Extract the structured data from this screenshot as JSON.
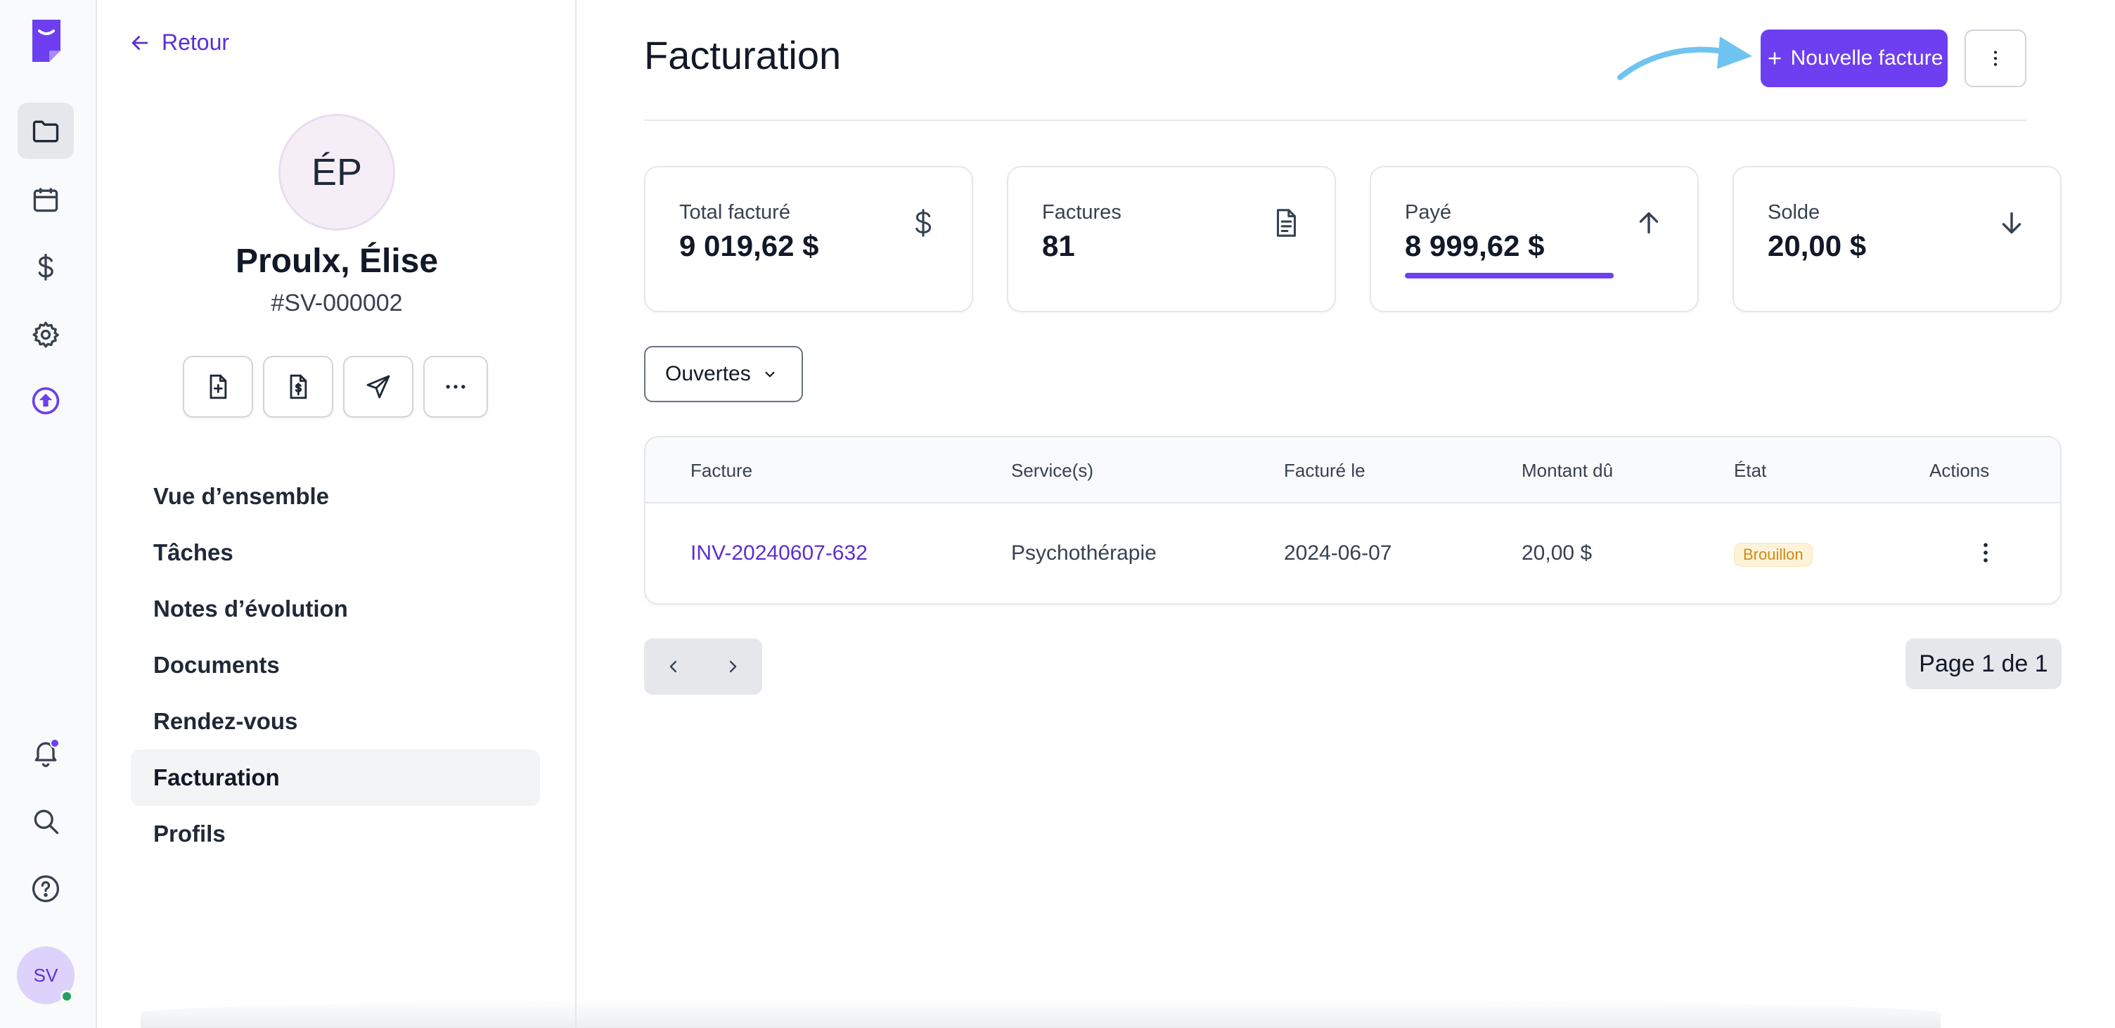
{
  "rail": {
    "items": [
      {
        "name": "rail-files",
        "icon": "folder-icon",
        "active": true
      },
      {
        "name": "rail-calendar",
        "icon": "calendar-icon",
        "active": false
      },
      {
        "name": "rail-billing",
        "icon": "dollar-icon",
        "active": false
      },
      {
        "name": "rail-settings",
        "icon": "gear-icon",
        "active": false
      },
      {
        "name": "rail-upgrade",
        "icon": "upload-circle-icon",
        "active": false
      }
    ],
    "bottom_items": [
      {
        "name": "rail-notifications",
        "icon": "bell-icon"
      },
      {
        "name": "rail-search",
        "icon": "search-icon"
      },
      {
        "name": "rail-help",
        "icon": "help-circle-icon"
      }
    ],
    "user_initials": "SV",
    "accent_color": "#6d3ff0"
  },
  "client": {
    "back_label": "Retour",
    "initials": "ÉP",
    "name": "Proulx, Élise",
    "id": "#SV-000002",
    "quick_actions": [
      "new-document-icon",
      "invoice-icon",
      "send-icon",
      "more-horizontal-icon"
    ],
    "nav": [
      {
        "label": "Vue d’ensemble",
        "active": false
      },
      {
        "label": "Tâches",
        "active": false
      },
      {
        "label": "Notes d’évolution",
        "active": false
      },
      {
        "label": "Documents",
        "active": false
      },
      {
        "label": "Rendez-vous",
        "active": false
      },
      {
        "label": "Facturation",
        "active": true
      },
      {
        "label": "Profils",
        "active": false
      }
    ]
  },
  "main": {
    "title": "Facturation",
    "new_invoice_label": "Nouvelle facture",
    "stats": [
      {
        "label": "Total facturé",
        "value": "9 019,62 $",
        "icon": "dollar-icon"
      },
      {
        "label": "Factures",
        "value": "81",
        "icon": "document-icon"
      },
      {
        "label": "Payé",
        "value": "8 999,62 $",
        "icon": "arrow-up-icon",
        "progress": 0.998
      },
      {
        "label": "Solde",
        "value": "20,00 $",
        "icon": "arrow-down-icon"
      }
    ],
    "filter_label": "Ouvertes",
    "table": {
      "headers": [
        "Facture",
        "Service(s)",
        "Facturé le",
        "Montant dû",
        "État",
        "Actions"
      ],
      "rows": [
        {
          "invoice": "INV-20240607-632",
          "service": "Psychothérapie",
          "date": "2024-06-07",
          "amount": "20,00 $",
          "status": "Brouillon"
        }
      ]
    },
    "page_indicator": "Page 1 de 1"
  }
}
